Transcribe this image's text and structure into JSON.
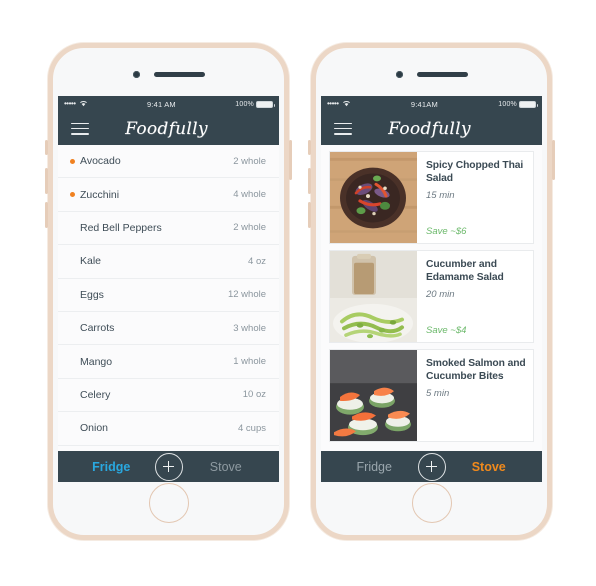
{
  "app": {
    "name": "Foodfully",
    "logo_text": "Foodfully"
  },
  "status_bar": {
    "signal_dots": "•••••",
    "wifi_icon": "wifi-icon",
    "time_left": "9:41 AM",
    "time_right": "9:41AM",
    "battery_text": "100%"
  },
  "nav": {
    "menu_icon": "hamburger-menu-icon"
  },
  "left_phone": {
    "screen_name": "fridge-ingredient-list",
    "ingredients": [
      {
        "name": "Avocado",
        "qty": "2 whole",
        "flagged": true
      },
      {
        "name": "Zucchini",
        "qty": "4 whole",
        "flagged": true
      },
      {
        "name": "Red Bell Peppers",
        "qty": "2 whole",
        "flagged": false
      },
      {
        "name": "Kale",
        "qty": "4 oz",
        "flagged": false
      },
      {
        "name": "Eggs",
        "qty": "12 whole",
        "flagged": false
      },
      {
        "name": "Carrots",
        "qty": "3 whole",
        "flagged": false
      },
      {
        "name": "Mango",
        "qty": "1 whole",
        "flagged": false
      },
      {
        "name": "Celery",
        "qty": "10 oz",
        "flagged": false
      },
      {
        "name": "Onion",
        "qty": "4 cups",
        "flagged": false
      }
    ],
    "tabs": {
      "fridge_label": "Fridge",
      "stove_label": "Stove",
      "add_label": "+",
      "active": "Fridge"
    }
  },
  "right_phone": {
    "screen_name": "stove-recipe-list",
    "recipes": [
      {
        "title": "Spicy Chopped Thai Salad",
        "time": "15 min",
        "save": "Save ~$6",
        "image_name": "thai-salad-photo"
      },
      {
        "title": "Cucumber and Edamame Salad",
        "time": "20 min",
        "save": "Save ~$4",
        "image_name": "edamame-salad-photo"
      },
      {
        "title": "Smoked Salmon and Cucumber Bites",
        "time": "5 min",
        "save": "",
        "image_name": "salmon-bites-photo"
      }
    ],
    "tabs": {
      "fridge_label": "Fridge",
      "stove_label": "Stove",
      "add_label": "+",
      "active": "Stove"
    }
  },
  "colors": {
    "nav_dark": "#36464f",
    "accent_orange": "#f08120",
    "accent_blue": "#29a8e0",
    "save_green": "#6cb96b",
    "frame_rose_gold": "#ecd7c6"
  }
}
